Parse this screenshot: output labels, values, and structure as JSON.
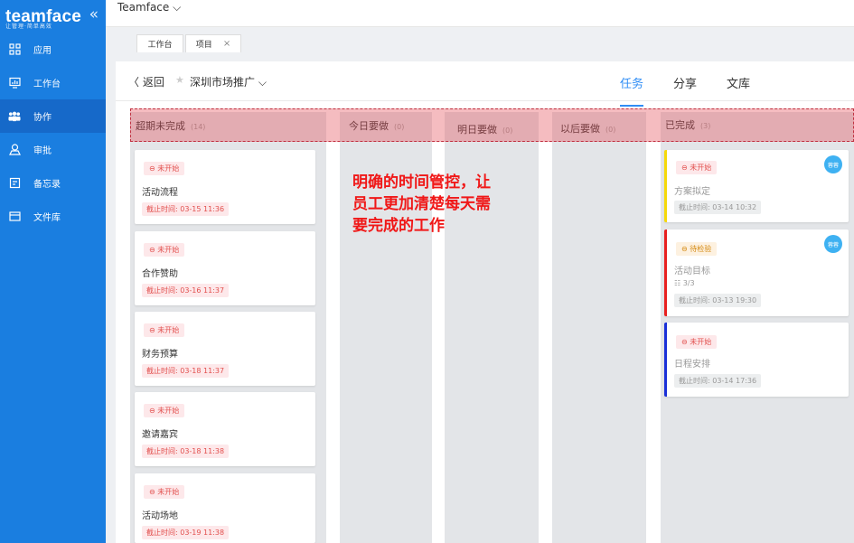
{
  "brand": {
    "logo": "teamface",
    "slogan": "让管理·简单高效",
    "collapse": "«"
  },
  "sidebar": {
    "items": [
      {
        "label": "应用"
      },
      {
        "label": "工作台"
      },
      {
        "label": "协作"
      },
      {
        "label": "审批"
      },
      {
        "label": "备忘录"
      },
      {
        "label": "文件库"
      }
    ]
  },
  "topbar": {
    "workspace": "Teamface ⌵"
  },
  "page_tabs": [
    {
      "label": "工作台"
    },
    {
      "label": "项目",
      "close": "×"
    }
  ],
  "header": {
    "back": "〈 返回",
    "star": "★",
    "project": "深圳市场推广 ⌵"
  },
  "view_tabs": {
    "task": "任务",
    "share": "分享",
    "library": "文库"
  },
  "columns": [
    {
      "title": "超期未完成",
      "count": "(14)"
    },
    {
      "title": "今日要做",
      "count": "(0)"
    },
    {
      "title": "明日要做",
      "count": "(0)"
    },
    {
      "title": "以后要做",
      "count": "(0)"
    },
    {
      "title": "已完成",
      "count": "(3)"
    }
  ],
  "overdue_cards": [
    {
      "status": "⊖ 未开始",
      "title": "活动流程",
      "deadline": "截止时间: 03-15 11:36"
    },
    {
      "status": "⊖ 未开始",
      "title": "合作赞助",
      "deadline": "截止时间: 03-16 11:37"
    },
    {
      "status": "⊖ 未开始",
      "title": "财务预算",
      "deadline": "截止时间: 03-18 11:37"
    },
    {
      "status": "⊖ 未开始",
      "title": "邀请嘉宾",
      "deadline": "截止时间: 03-18 11:38"
    },
    {
      "status": "⊖ 未开始",
      "title": "活动场地",
      "deadline": "截止时间: 03-19 11:38"
    }
  ],
  "done_cards": [
    {
      "status": "⊖ 未开始",
      "title": "方案拟定",
      "deadline": "截止时间: 03-14 10:32",
      "avatar": "蓉蓉",
      "accent": "#f5d90a"
    },
    {
      "status": "⊖ 待检验",
      "title": "活动目标",
      "sub": "☷ 3/3",
      "deadline": "截止时间: 03-13 19:30",
      "avatar": "蓉蓉",
      "accent": "#e82020"
    },
    {
      "status": "⊖ 未开始",
      "title": "日程安排",
      "deadline": "截止时间: 03-14 17:36",
      "accent": "#1a30d8"
    }
  ],
  "annotation": "明确的时间管控，让\n员工更加清楚每天需\n要完成的工作",
  "colors": {
    "sidebar": "#1a7ee0",
    "accent": "#2f8df5",
    "overlay": "#e6505a",
    "annotation": "#f01818"
  }
}
